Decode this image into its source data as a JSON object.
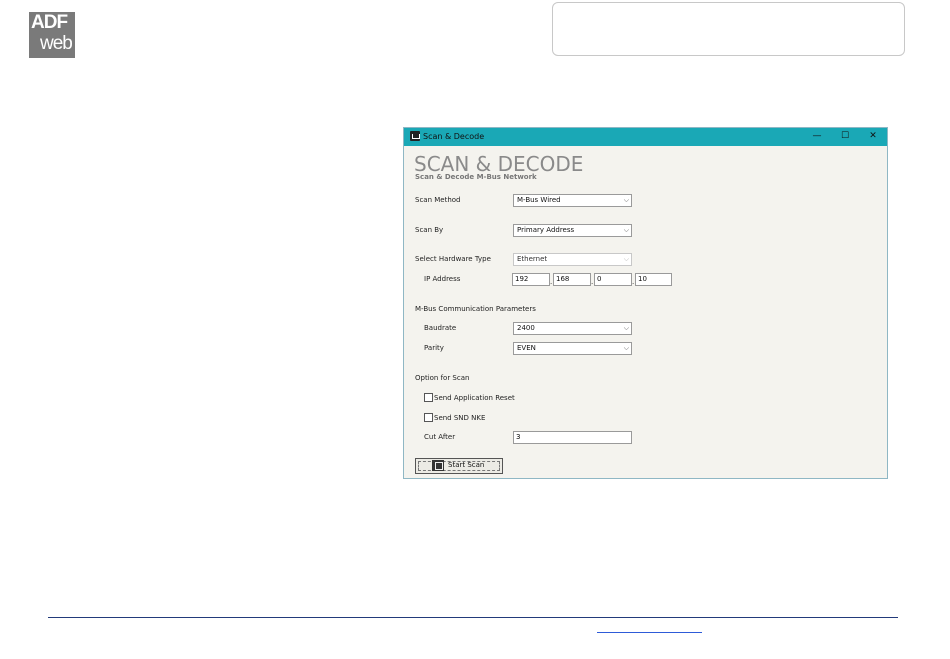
{
  "logo": {
    "line1": "ADF",
    "line2": "web"
  },
  "window": {
    "title": "Scan & Decode",
    "minimize": "—",
    "maximize": "☐",
    "close": "✕",
    "heading": "SCAN & DECODE",
    "subheading": "Scan & Decode M-Bus Network"
  },
  "form": {
    "scan_method_label": "Scan Method",
    "scan_method_value": "M-Bus Wired",
    "scan_by_label": "Scan By",
    "scan_by_value": "Primary Address",
    "hardware_label": "Select Hardware Type",
    "hardware_value": "Ethernet",
    "ip_label": "IP Address",
    "ip": [
      "192",
      "168",
      "0",
      "10"
    ],
    "comm_label": "M-Bus Communication Parameters",
    "baudrate_label": "Baudrate",
    "baudrate_value": "2400",
    "parity_label": "Parity",
    "parity_value": "EVEN",
    "option_label": "Option for Scan",
    "send_reset_label": "Send Application Reset",
    "send_snd_label": "Send SND NKE",
    "cut_after_label": "Cut After",
    "cut_after_value": "3",
    "start_scan": "Start Scan"
  },
  "icons": {
    "dropdown": "chevron-down-icon",
    "app": "adfweb-app-icon"
  }
}
